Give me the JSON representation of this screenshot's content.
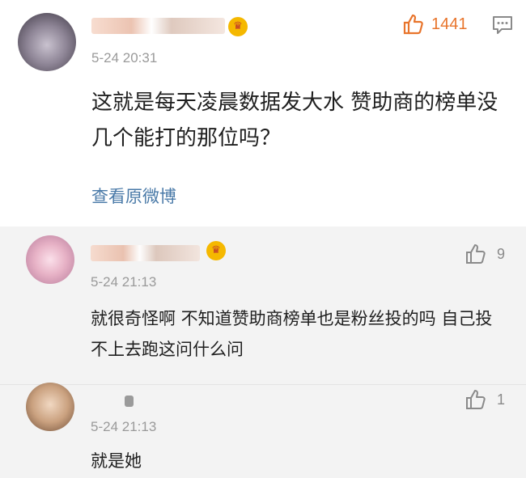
{
  "post": {
    "time": "5-24 20:31",
    "likes": "1441",
    "content": "这就是每天凌晨数据发大水 赞助商的榜单没几个能打的那位吗？",
    "view_original": "查看原微博",
    "avatar_icon": "user-avatar-icon",
    "badge_icon": "vip-crown-icon",
    "like_icon": "thumbs-up-icon",
    "comment_icon": "comment-icon",
    "accent_color": "#e8742b",
    "link_color": "#4a7aa8"
  },
  "replies": [
    {
      "time": "5-24 21:13",
      "likes": "9",
      "content": "就很奇怪啊 不知道赞助商榜单也是粉丝投的吗 自己投不上去跑这问什么问"
    },
    {
      "time": "5-24 21:13",
      "likes": "1",
      "content": "就是她"
    }
  ]
}
